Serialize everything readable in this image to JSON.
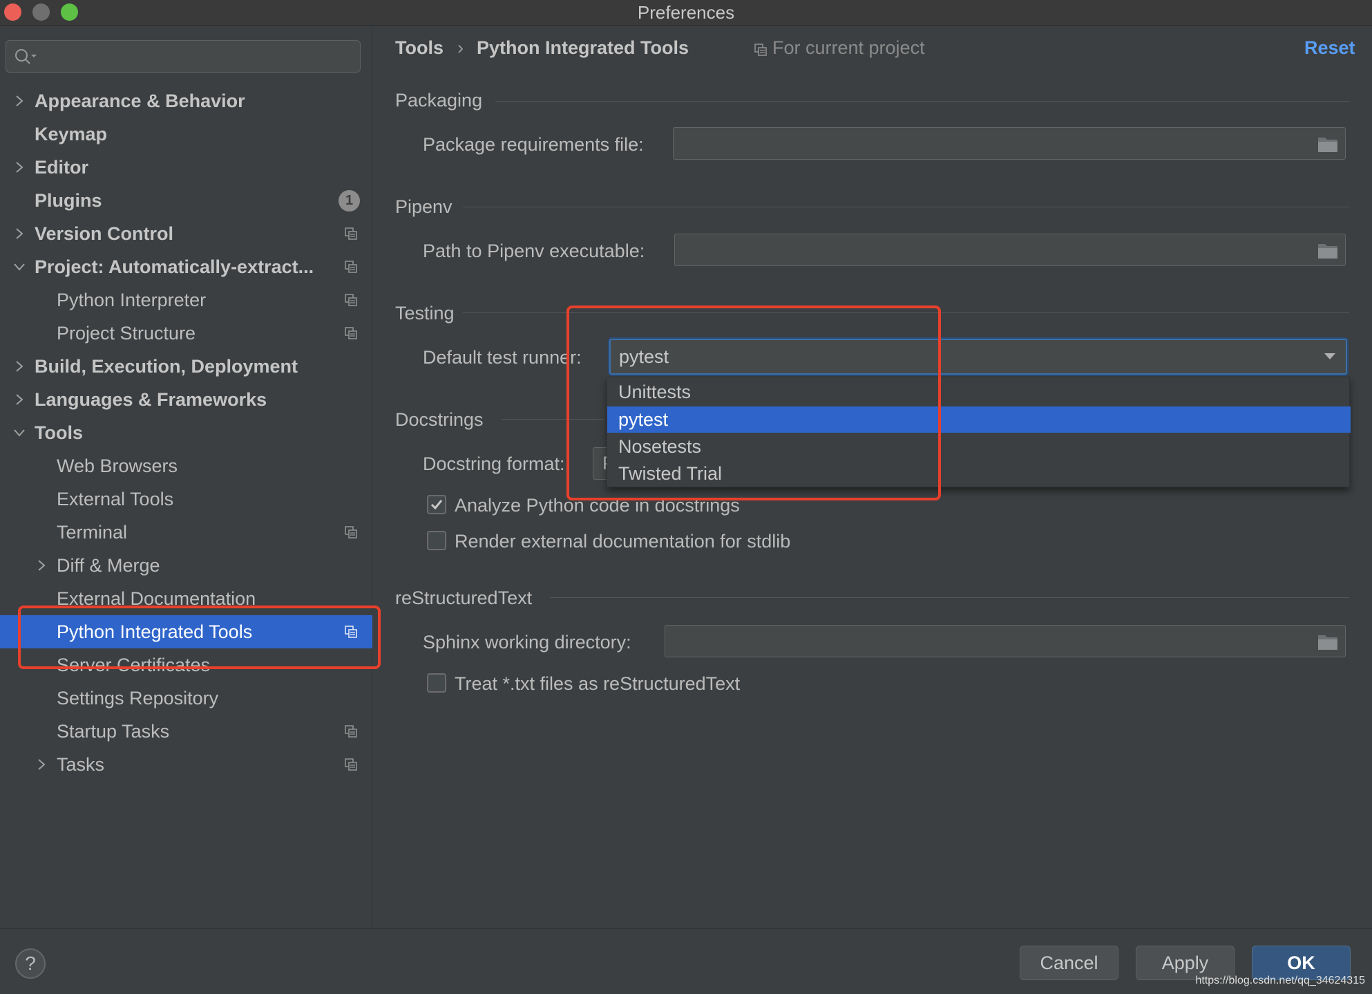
{
  "window": {
    "title": "Preferences"
  },
  "search": {
    "placeholder": ""
  },
  "sidebar": {
    "items": [
      {
        "label": "Appearance & Behavior"
      },
      {
        "label": "Keymap"
      },
      {
        "label": "Editor"
      },
      {
        "label": "Plugins",
        "badge": "1"
      },
      {
        "label": "Version Control"
      },
      {
        "label": "Project: Automatically-extract..."
      },
      {
        "label": "Python Interpreter"
      },
      {
        "label": "Project Structure"
      },
      {
        "label": "Build, Execution, Deployment"
      },
      {
        "label": "Languages & Frameworks"
      },
      {
        "label": "Tools"
      },
      {
        "label": "Web Browsers"
      },
      {
        "label": "External Tools"
      },
      {
        "label": "Terminal"
      },
      {
        "label": "Diff & Merge"
      },
      {
        "label": "External Documentation"
      },
      {
        "label": "Python Integrated Tools"
      },
      {
        "label": "Server Certificates"
      },
      {
        "label": "Settings Repository"
      },
      {
        "label": "Startup Tasks"
      },
      {
        "label": "Tasks"
      }
    ]
  },
  "header": {
    "crumb_parent": "Tools",
    "crumb_separator": "›",
    "crumb_current": "Python Integrated Tools",
    "scope": "For current project",
    "reset_label": "Reset"
  },
  "packaging": {
    "title": "Packaging",
    "requirements_label": "Package requirements file:",
    "requirements_value": ""
  },
  "pipenv": {
    "title": "Pipenv",
    "path_label": "Path to Pipenv executable:",
    "path_value": ""
  },
  "testing": {
    "title": "Testing",
    "runner_label": "Default test runner:",
    "runner_value": "pytest",
    "options": [
      "Unittests",
      "pytest",
      "Nosetests",
      "Twisted Trial"
    ],
    "selected_option": "pytest"
  },
  "docstrings": {
    "title": "Docstrings",
    "format_label": "Docstring format:",
    "format_value_partial": "P",
    "analyze_label": "Analyze Python code in docstrings",
    "analyze_checked": true,
    "render_label": "Render external documentation for stdlib",
    "render_checked": false
  },
  "rest": {
    "title": "reStructuredText",
    "sphinx_label": "Sphinx working directory:",
    "sphinx_value": "",
    "treat_label": "Treat *.txt files as reStructuredText",
    "treat_checked": false
  },
  "footer": {
    "help_label": "?",
    "cancel_label": "Cancel",
    "apply_label": "Apply",
    "ok_label": "OK",
    "watermark": "https://blog.csdn.net/qq_34624315"
  },
  "colors": {
    "selection": "#2f65ca",
    "link": "#589df6",
    "annotation": "#e8402c",
    "background": "#3c3f41"
  }
}
